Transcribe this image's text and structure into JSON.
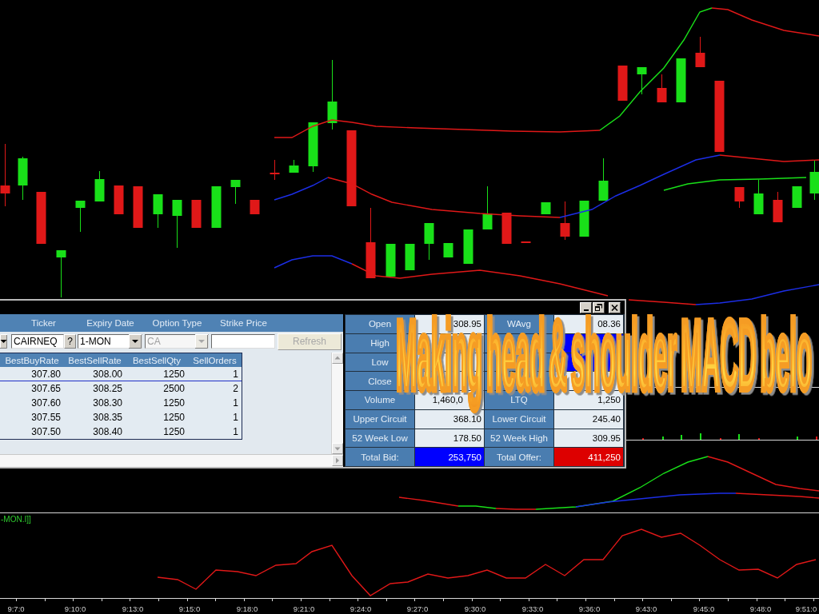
{
  "order_window": {
    "query_form": {
      "column_labels": [
        "Ticker",
        "Expiry Date",
        "Option Type",
        "Strike Price"
      ],
      "ticker": {
        "value": "CAIRNEQ",
        "help_button": "?"
      },
      "expiry_date": {
        "value": "1-MON",
        "disabled": false
      },
      "option_type": {
        "value": "CA",
        "disabled": true
      },
      "refresh_button": {
        "label": "Refresh",
        "disabled": true
      }
    },
    "depth_table": {
      "columns": [
        "BestBuyRate",
        "BestSellRate",
        "BestSellQty",
        "SellOrders"
      ],
      "rows": [
        {
          "cells": [
            "307.80",
            "308.00",
            "1250",
            "1"
          ],
          "selected": true
        },
        {
          "cells": [
            "307.65",
            "308.25",
            "2500",
            "2"
          ],
          "selected": false
        },
        {
          "cells": [
            "307.60",
            "308.30",
            "1250",
            "1"
          ],
          "selected": false
        },
        {
          "cells": [
            "307.55",
            "308.35",
            "1250",
            "1"
          ],
          "selected": false
        },
        {
          "cells": [
            "307.50",
            "308.40",
            "1250",
            "1"
          ],
          "selected": false
        }
      ]
    },
    "quote_grid": {
      "rows": [
        {
          "cells": [
            {
              "kind": "label",
              "text": "Open"
            },
            {
              "kind": "value",
              "text": "308.95"
            },
            {
              "kind": "label",
              "text": "WAvg"
            },
            {
              "kind": "value",
              "text": "08.36"
            }
          ]
        },
        {
          "cells": [
            {
              "kind": "label",
              "text": "High"
            },
            {
              "kind": "value"
            },
            {
              "kind": "label"
            },
            {
              "kind": "value",
              "color": "#0000ff"
            }
          ]
        },
        {
          "cells": [
            {
              "kind": "label",
              "text": "Low"
            },
            {
              "kind": "value"
            },
            {
              "kind": "label"
            },
            {
              "kind": "value",
              "color": "#0000ff"
            }
          ]
        },
        {
          "cells": [
            {
              "kind": "label",
              "text": "Close"
            },
            {
              "kind": "value"
            },
            {
              "kind": "label"
            },
            {
              "kind": "value"
            }
          ]
        },
        {
          "cells": [
            {
              "kind": "label",
              "text": "Volume"
            },
            {
              "kind": "partial_value",
              "text": "1,460,0"
            },
            {
              "kind": "label",
              "text": "LTQ"
            },
            {
              "kind": "value",
              "text": "1,250"
            }
          ]
        },
        {
          "cells": [
            {
              "kind": "label",
              "text": "Upper Circuit"
            },
            {
              "kind": "value",
              "text": "368.10"
            },
            {
              "kind": "label",
              "text": "Lower Circuit"
            },
            {
              "kind": "value",
              "text": "245.40"
            }
          ]
        },
        {
          "cells": [
            {
              "kind": "label",
              "text": "52 Week Low"
            },
            {
              "kind": "value",
              "text": "178.50"
            },
            {
              "kind": "label",
              "text": "52 Week High"
            },
            {
              "kind": "value",
              "text": "309.95"
            }
          ]
        },
        {
          "cells": [
            {
              "kind": "label",
              "text": "Total Bid:"
            },
            {
              "kind": "value",
              "text": "253,750",
              "color": "#0000ff"
            },
            {
              "kind": "label",
              "text": "Total Offer:"
            },
            {
              "kind": "value",
              "text": "411,250",
              "color": "#dd0000"
            }
          ]
        }
      ]
    }
  },
  "caption": "Making head & shoulder MACD belo",
  "indicator_label": "-MON.I]]",
  "time_axis": {
    "labels": [
      "9:7:0",
      "9:10:0",
      "9:13:0",
      "9:15:0",
      "9:18:0",
      "9:21:0",
      "9:24:0",
      "9:27:0",
      "9:30:0",
      "9:33:0",
      "9:36:0",
      "9:43:0",
      "9:45:0",
      "9:48:0",
      "9:51:0"
    ]
  }
}
